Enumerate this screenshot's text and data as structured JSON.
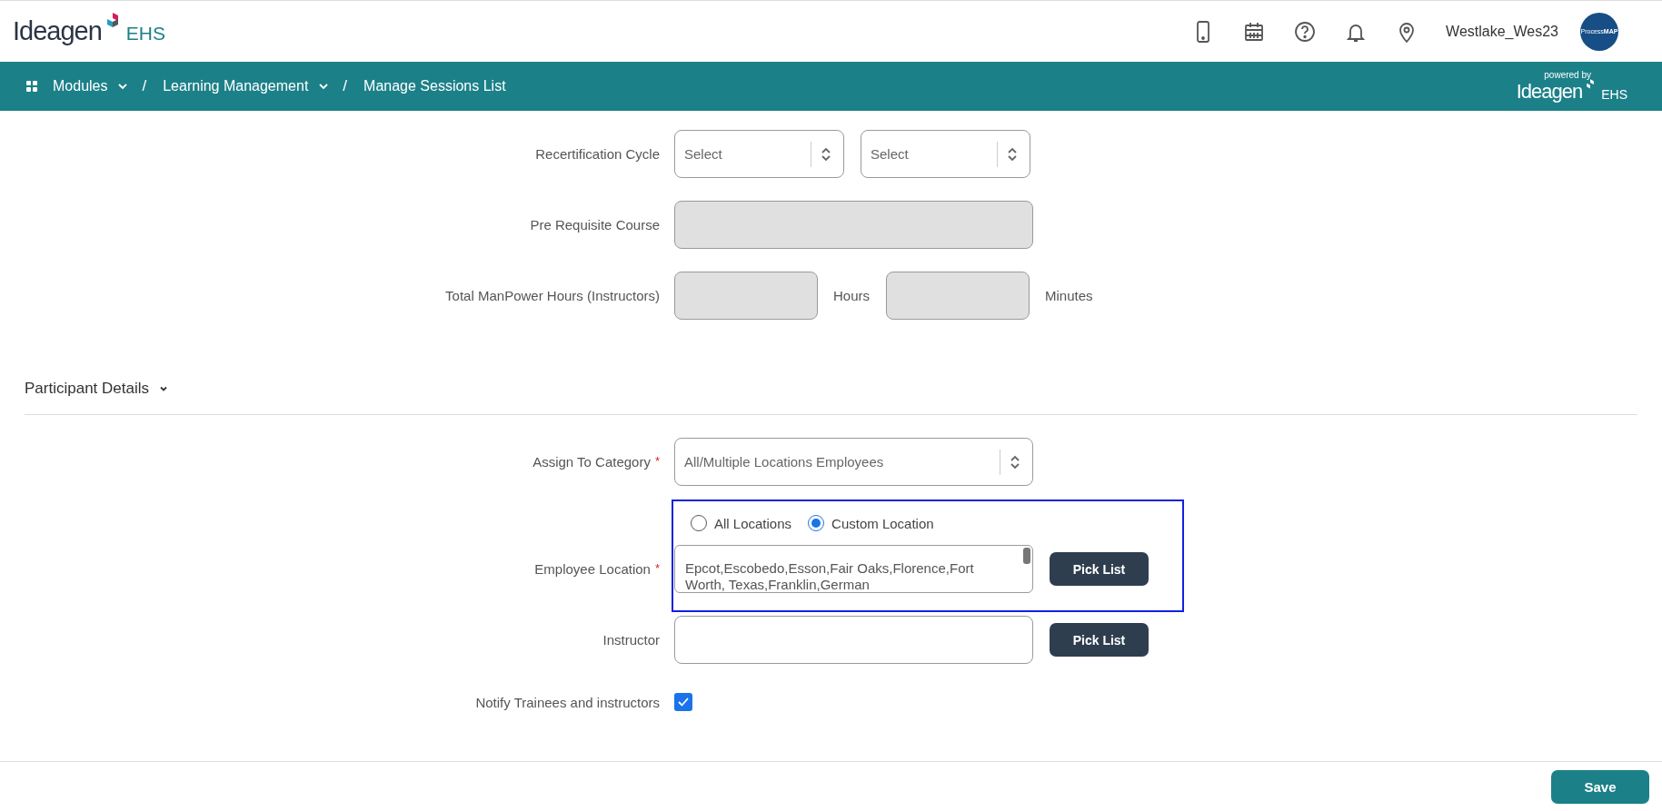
{
  "header": {
    "logo": {
      "wordmark": "Ideagen",
      "suffix": "EHS"
    },
    "user": "Westlake_Wes23",
    "avatar_text": "Process**MAP**"
  },
  "breadcrumb": [
    {
      "label": "Modules",
      "dropdown": true,
      "separator": "/"
    },
    {
      "label": "Learning Management",
      "dropdown": true,
      "separator": "/"
    },
    {
      "label": "Manage Sessions List",
      "dropdown": false
    }
  ],
  "powered_by": {
    "text": "powered by",
    "wordmark": "Ideagen",
    "suffix": "EHS"
  },
  "top_rows": [
    {
      "kind": "select-pair",
      "label": "Recertification Cycle",
      "selects": [
        {
          "placeholder": "Select"
        },
        {
          "placeholder": "Select"
        }
      ]
    },
    {
      "kind": "text",
      "label": "Pre Requisite Course",
      "disabled": true
    },
    {
      "kind": "duration",
      "label": "Total ManPower Hours (Instructors)",
      "fields": [
        {
          "unit": "Hours",
          "disabled": true
        },
        {
          "unit": "Minutes",
          "disabled": true
        }
      ]
    }
  ],
  "section": {
    "title": "Participant Details",
    "expanded": true
  },
  "section_rows": [
    {
      "kind": "select",
      "label": "Assign To Category",
      "required_mark": "*",
      "value": "All/Multiple Locations Employees"
    },
    {
      "kind": "location",
      "highlighted": true,
      "label": "Employee Location",
      "required_mark": "*",
      "options": [
        {
          "label": "All Locations",
          "selected": false
        },
        {
          "label": "Custom Location",
          "selected": true
        }
      ],
      "value": "Epcot,Escobedo,Esson,Fair Oaks,Florence,Fort Worth, Texas,Franklin,German",
      "button": "Pick List"
    },
    {
      "kind": "picker",
      "label": "Instructor",
      "button": "Pick List"
    },
    {
      "kind": "checkbox",
      "label": "Notify Trainees and instructors",
      "checked": true
    }
  ],
  "save_button": "Save"
}
